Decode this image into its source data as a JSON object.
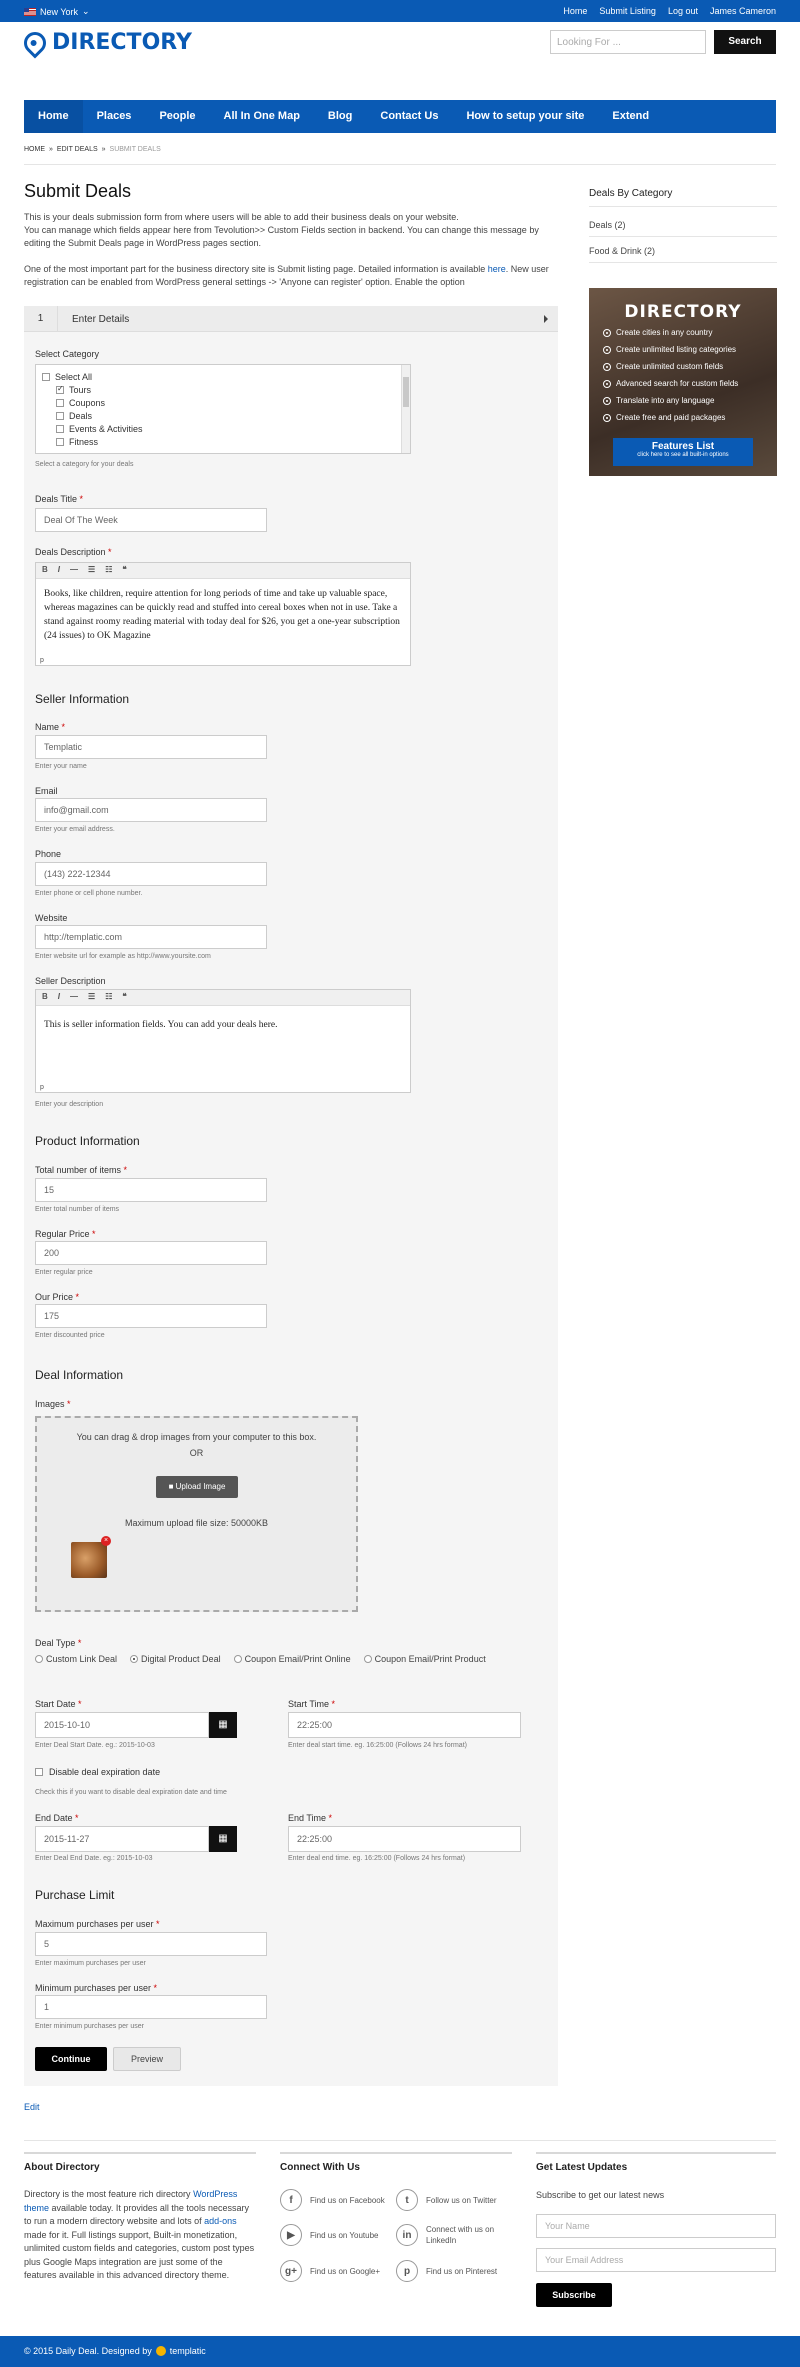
{
  "topbar": {
    "location": "New York",
    "links": [
      "Home",
      "Submit Listing",
      "Log out",
      "James Cameron"
    ]
  },
  "header": {
    "logo": "DIRECTORY",
    "search_placeholder": "Looking For ...",
    "search_button": "Search"
  },
  "nav": [
    "Home",
    "Places",
    "People",
    "All In One Map",
    "Blog",
    "Contact Us",
    "How to setup your site",
    "Extend"
  ],
  "breadcrumb": [
    "HOME",
    "EDIT DEALS",
    "SUBMIT DEALS"
  ],
  "page": {
    "title": "Submit Deals",
    "intro1": "This is your deals submission form from where users will be able to add their business deals on your website.",
    "intro2": "You can manage which fields appear here from Tevolution>> Custom Fields section in backend. You can change this message by editing the Submit Deals page in WordPress pages section.",
    "intro3a": "One of the most important part for the business directory site is Submit listing page. Detailed information is available ",
    "intro3link": "here",
    "intro3b": ". New user registration can be enabled from WordPress general settings -> 'Anyone can register' option. Enable the option"
  },
  "step": {
    "number": "1",
    "label": "Enter Details"
  },
  "category": {
    "label": "Select Category",
    "items": [
      {
        "label": "Select All",
        "checked": false
      },
      {
        "label": "Tours",
        "checked": true
      },
      {
        "label": "Coupons",
        "checked": false
      },
      {
        "label": "Deals",
        "checked": false
      },
      {
        "label": "Events & Activities",
        "checked": false
      },
      {
        "label": "Fitness",
        "checked": false
      }
    ],
    "help": "Select a category for your deals"
  },
  "deal_title": {
    "label": "Deals Title",
    "value": "Deal Of The Week"
  },
  "deal_desc": {
    "label": "Deals Description",
    "body": "Books, like children, require attention for long periods of time and take up valuable space, whereas magazines can be quickly read and stuffed into cereal boxes when not in use. Take a stand against roomy reading material with today deal for $26, you get a one-year subscription (24 issues) to OK Magazine",
    "footer": "p"
  },
  "seller": {
    "heading": "Seller Information",
    "name": {
      "label": "Name",
      "value": "Templatic",
      "help": "Enter your name"
    },
    "email": {
      "label": "Email",
      "value": "info@gmail.com",
      "help": "Enter your email address."
    },
    "phone": {
      "label": "Phone",
      "value": "(143) 222-12344",
      "help": "Enter phone or cell phone number."
    },
    "website": {
      "label": "Website",
      "value": "http://templatic.com",
      "help": "Enter website url for example as http://www.yoursite.com"
    },
    "desc": {
      "label": "Seller Description",
      "body": "This is seller information fields. You can add your deals here.",
      "footer": "p",
      "help": "Enter your description"
    }
  },
  "editor_toolbar": [
    "B",
    "I",
    "—",
    "☰",
    "☷",
    "❝"
  ],
  "product": {
    "heading": "Product Information",
    "total": {
      "label": "Total number of items",
      "value": "15",
      "help": "Enter total number of items"
    },
    "regular": {
      "label": "Regular Price",
      "value": "200",
      "help": "Enter regular price"
    },
    "our": {
      "label": "Our Price",
      "value": "175",
      "help": "Enter discounted price"
    }
  },
  "deal_info": {
    "heading": "Deal Information",
    "images_label": "Images",
    "drop_text": "You can drag & drop images from your computer to this box.",
    "or": "OR",
    "upload_button": "Upload Image",
    "max_size": "Maximum upload file size: 50000KB",
    "deal_type_label": "Deal Type",
    "deal_types": [
      {
        "label": "Custom Link Deal",
        "selected": false
      },
      {
        "label": "Digital Product Deal",
        "selected": true
      },
      {
        "label": "Coupon Email/Print Online",
        "selected": false
      },
      {
        "label": "Coupon Email/Print Product",
        "selected": false
      }
    ],
    "start_date": {
      "label": "Start Date",
      "value": "2015-10-10",
      "help": "Enter Deal Start Date. eg.: 2015-10-03"
    },
    "start_time": {
      "label": "Start Time",
      "value": "22:25:00",
      "help": "Enter deal start time. eg. 16:25:00 (Follows 24 hrs format)"
    },
    "disable_exp": {
      "label": "Disable deal expiration date",
      "help": "Check this if you want to disable deal expiration date and time"
    },
    "end_date": {
      "label": "End Date",
      "value": "2015-11-27",
      "help": "Enter Deal End Date. eg.: 2015-10-03"
    },
    "end_time": {
      "label": "End Time",
      "value": "22:25:00",
      "help": "Enter deal end time. eg. 16:25:00 (Follows 24 hrs format)"
    }
  },
  "purchase": {
    "heading": "Purchase Limit",
    "max": {
      "label": "Maximum purchases per user",
      "value": "5",
      "help": "Enter maximum purchases per user"
    },
    "min": {
      "label": "Minimum purchases per user",
      "value": "1",
      "help": "Enter minimum purchases per user"
    }
  },
  "buttons": {
    "continue": "Continue",
    "preview": "Preview"
  },
  "edit_link": "Edit",
  "sidebar": {
    "heading": "Deals By Category",
    "items": [
      "Deals (2)",
      "Food & Drink (2)"
    ],
    "promo": {
      "title": "DIRECTORY",
      "features": [
        "Create cities in any country",
        "Create unlimited listing categories",
        "Create unlimited custom fields",
        "Advanced search for custom fields",
        "Translate into any language",
        "Create free and paid packages"
      ],
      "button_title": "Features List",
      "button_sub": "click here to see all built-in options"
    }
  },
  "footer": {
    "about_heading": "About Directory",
    "about_text_1": "Directory is the most feature rich directory ",
    "about_link_1": "WordPress theme",
    "about_text_2": " available today. It provides all the tools necessary to run a modern directory website and lots of ",
    "about_link_2": "add-ons",
    "about_text_3": " made for it. Full listings support, Built-in monetization, unlimited custom fields and categories, custom post types plus Google Maps integration are just some of the features available in this advanced directory theme.",
    "connect_heading": "Connect With Us",
    "social": [
      {
        "label": "Find us on Facebook",
        "icon": "facebook-icon"
      },
      {
        "label": "Follow us on Twitter",
        "icon": "twitter-icon"
      },
      {
        "label": "Find us on Youtube",
        "icon": "youtube-icon"
      },
      {
        "label": "Connect with us on LinkedIn",
        "icon": "linkedin-icon"
      },
      {
        "label": "Find us on Google+",
        "icon": "googleplus-icon"
      },
      {
        "label": "Find us on Pinterest",
        "icon": "pinterest-icon"
      }
    ],
    "updates_heading": "Get Latest Updates",
    "updates_text": "Subscribe to get our latest news",
    "name_placeholder": "Your Name",
    "email_placeholder": "Your Email Address",
    "subscribe": "Subscribe",
    "copyright": "© 2015 Daily Deal. Designed by",
    "designer": "templatic"
  },
  "colors": {
    "brand": "#0a5ab4",
    "button": "#000000"
  }
}
